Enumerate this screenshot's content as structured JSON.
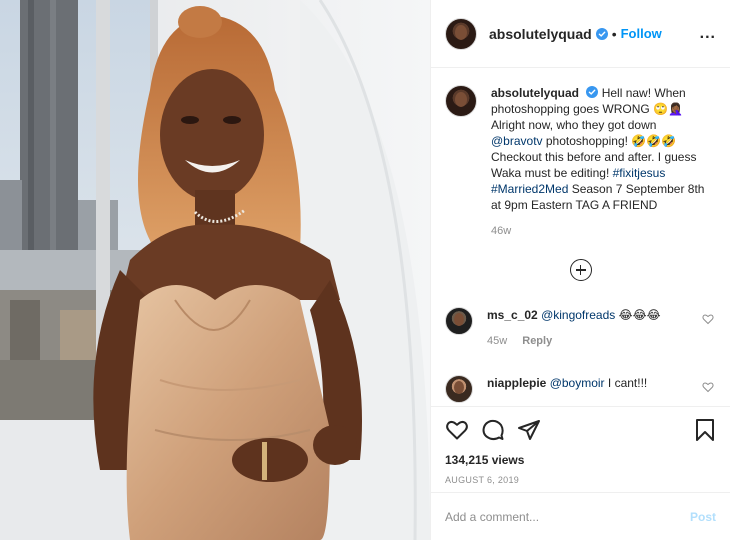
{
  "post": {
    "image_alt": "Woman in a satin dress standing by a window with a city skyline"
  },
  "header": {
    "username": "absolutelyquad",
    "separator": "•",
    "follow_label": "Follow",
    "more_label": "..."
  },
  "caption": {
    "username": "absolutelyquad",
    "line1": " Hell naw! When photoshopping goes WRONG 🙄🤦🏾‍♀️ Alright now, who they got down ",
    "mention": "@bravotv",
    "line2": " photoshopping! 🤣🤣🤣 Checkout this before and after. I guess Waka must be editing! ",
    "hashtag1": "#fixitjesus",
    "hashtag2": "#Married2Med",
    "line3": " Season 7 September 8th at 9pm Eastern TAG A FRIEND",
    "time": "46w"
  },
  "comments": [
    {
      "username": "ms_c_02",
      "mention": "@kingofreads",
      "text": " 😂😂😂",
      "time": "45w",
      "reply_label": "Reply"
    },
    {
      "username": "niapplepie",
      "mention": "@boymoir",
      "text": " I cant!!!"
    }
  ],
  "stats": {
    "views": "134,215 views",
    "date": "AUGUST 6, 2019"
  },
  "add_comment": {
    "placeholder": "Add a comment...",
    "post_label": "Post"
  },
  "colors": {
    "accent": "#0095f6",
    "verified": "#3897f0",
    "muted": "#8e8e8e",
    "dress": "#d9b08c"
  }
}
